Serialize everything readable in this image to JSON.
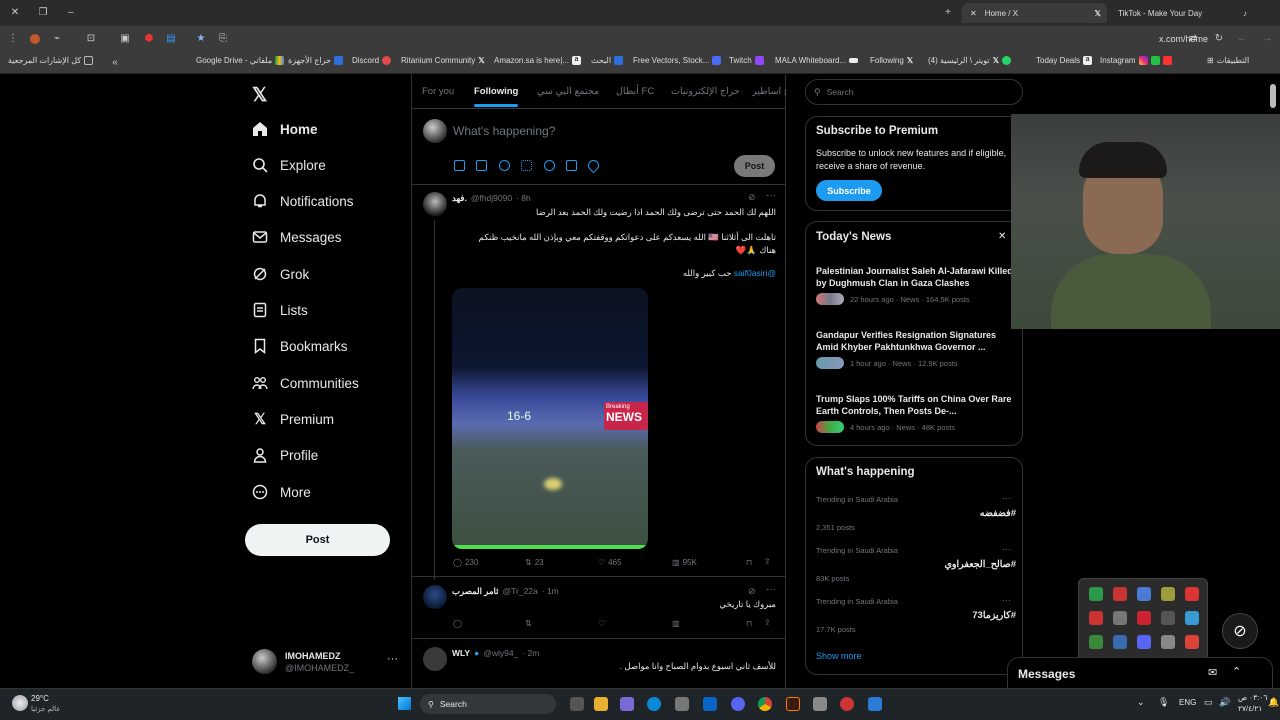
{
  "browser": {
    "tabs": [
      {
        "label": "Home / X"
      },
      {
        "label": "TikTok - Make Your Day"
      }
    ],
    "url": "x.com/home",
    "bookmarks": [
      {
        "label": "كل الإشارات المرجعية"
      },
      {
        "label": "Google Drive - ملفاتي"
      },
      {
        "label": "حراج الأجهزة"
      },
      {
        "label": "Discord"
      },
      {
        "label": "Ritanium Community"
      },
      {
        "label": "Amazon.sa is here|..."
      },
      {
        "label": "البحث"
      },
      {
        "label": "Free Vectors, Stock..."
      },
      {
        "label": "Twitch"
      },
      {
        "label": "MALA Whiteboard..."
      },
      {
        "label": "Following"
      },
      {
        "label": "(4) تويتر \\ الرئيسية"
      },
      {
        "label": "Today Deals"
      },
      {
        "label": "Instagram"
      },
      {
        "label": "التطبيقات"
      }
    ]
  },
  "sidebar": {
    "items": [
      {
        "label": "Home"
      },
      {
        "label": "Explore"
      },
      {
        "label": "Notifications"
      },
      {
        "label": "Messages"
      },
      {
        "label": "Grok"
      },
      {
        "label": "Lists"
      },
      {
        "label": "Bookmarks"
      },
      {
        "label": "Communities"
      },
      {
        "label": "Premium"
      },
      {
        "label": "Profile"
      },
      {
        "label": "More"
      }
    ],
    "post_label": "Post",
    "account": {
      "name": "IMOHAMEDZ",
      "handle": "@IMOHAMEDZ_"
    }
  },
  "timeline": {
    "tabs": [
      "For you",
      "Following",
      "مجتمع البي سي",
      "أبطال FC",
      "حراج الإلكترونيات",
      "حراج اساطير"
    ],
    "composer": {
      "placeholder": "What's happening?",
      "post_label": "Post"
    },
    "tweets": [
      {
        "name": "فهد.",
        "handle": "@fhdj9090",
        "time": "· 8h",
        "lines": [
          "اللهم لك الحمد حتى ترضى ولك الحمد اذا رضيت ولك الحمد بعد الرضا",
          "تاهلت الى أثلاثنا 🇺🇸 الله يسعدكم على دعواتكم ووقفتكم معي وبإذن الله مانخيب ظنكم",
          "هناك 🙏❤️"
        ],
        "mention": "@saif0asiri",
        "mention_text": "حب كبير والله",
        "video": {
          "score": "16-6",
          "badge_top": "Breaking",
          "badge_bottom": "NEWS"
        },
        "replies": "230",
        "reposts": "23",
        "likes": "465",
        "views": "95K"
      },
      {
        "name": "ثامر المصرب",
        "handle": "@Tr_22a",
        "time": "· 1m",
        "lines": [
          "مبروك يا تاريخي"
        ]
      },
      {
        "name": "WLY",
        "handle": "@wly94_",
        "time": "· 2m",
        "lines": [
          "للأسف ثاني اسبوع بدوام الصباح وانا مواصل ."
        ]
      }
    ]
  },
  "right": {
    "search_placeholder": "Search",
    "premium": {
      "title": "Subscribe to Premium",
      "body": "Subscribe to unlock new features and if eligible, receive a share of revenue.",
      "button": "Subscribe"
    },
    "news": {
      "title": "Today's News",
      "items": [
        {
          "title": "Palestinian Journalist Saleh Al-Jafarawi Killed by Dughmush Clan in Gaza Clashes",
          "meta": "22 hours ago · News · 164.5K posts"
        },
        {
          "title": "Gandapur Verifies Resignation Signatures Amid Khyber Pakhtunkhwa Governor ...",
          "meta": "1 hour ago · News · 12.9K posts"
        },
        {
          "title": "Trump Slaps 100% Tariffs on China Over Rare Earth Controls, Then Posts De-...",
          "meta": "4 hours ago · News · 48K posts"
        }
      ]
    },
    "happening": {
      "title": "What's happening",
      "items": [
        {
          "context": "Trending in Saudi Arabia",
          "tag": "#فضفضه",
          "posts": "2,351 posts"
        },
        {
          "context": "Trending in Saudi Arabia",
          "tag": "#صالح_الجعفراوي",
          "posts": "83K posts"
        },
        {
          "context": "Trending in Saudi Arabia",
          "tag": "#كاريزما73",
          "posts": "17.7K posts"
        }
      ],
      "show_more": "Show more"
    },
    "messages_label": "Messages"
  },
  "taskbar": {
    "weather_temp": "29°C",
    "weather_text": "عالم جزئيا",
    "search_label": "Search",
    "lang": "ENG",
    "time": "٠٣:٠٦ ص",
    "date": "٢٧/٤/٢١"
  },
  "colors": {
    "accent": "#1d9bf0",
    "bg": "#000000",
    "border": "#2f3336",
    "muted": "#71767b"
  }
}
